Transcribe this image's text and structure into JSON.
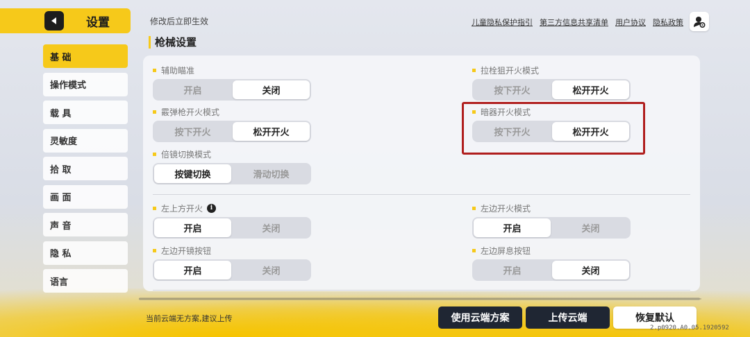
{
  "header": {
    "title": "设置",
    "hint": "修改后立即生效",
    "links": [
      "儿童隐私保护指引",
      "第三方信息共享清单",
      "用户协议",
      "隐私政策"
    ]
  },
  "section_title": "枪械设置",
  "sidebar": {
    "items": [
      {
        "label": "基 础",
        "active": true
      },
      {
        "label": "操作模式",
        "active": false
      },
      {
        "label": "载 具",
        "active": false
      },
      {
        "label": "灵敏度",
        "active": false
      },
      {
        "label": "拾 取",
        "active": false
      },
      {
        "label": "画 面",
        "active": false
      },
      {
        "label": "声 音",
        "active": false
      },
      {
        "label": "隐 私",
        "active": false
      },
      {
        "label": "语言",
        "active": false
      }
    ]
  },
  "options": {
    "aim_assist": {
      "label": "辅助瞄准",
      "a": "开启",
      "b": "关闭",
      "selected": "b"
    },
    "shotgun_fire": {
      "label": "霰弹枪开火模式",
      "a": "按下开火",
      "b": "松开开火",
      "selected": "b"
    },
    "scope_switch": {
      "label": "倍镜切换模式",
      "a": "按键切换",
      "b": "滑动切换",
      "selected": "a"
    },
    "bolt_sniper_fire": {
      "label": "拉栓狙开火模式",
      "a": "按下开火",
      "b": "松开开火",
      "selected": "b"
    },
    "throwable_fire": {
      "label": "暗器开火模式",
      "a": "按下开火",
      "b": "松开开火",
      "selected": "b"
    },
    "top_left_fire": {
      "label": "左上方开火",
      "a": "开启",
      "b": "关闭",
      "selected": "a"
    },
    "left_scope_btn": {
      "label": "左边开镜按钮",
      "a": "开启",
      "b": "关闭",
      "selected": "a"
    },
    "left_fire_mode": {
      "label": "左边开火模式",
      "a": "开启",
      "b": "关闭",
      "selected": "a"
    },
    "left_hold_breath": {
      "label": "左边屏息按钮",
      "a": "开启",
      "b": "关闭",
      "selected": "b"
    }
  },
  "bottom": {
    "hint": "当前云端无方案,建议上传",
    "use_cloud": "使用云端方案",
    "upload_cloud": "上传云端",
    "restore_default": "恢复默认",
    "version": "2.p0920.A0.05.1920592"
  },
  "icons": {
    "back": "back-arrow-icon",
    "user": "user-settings-icon",
    "info": "info-icon"
  },
  "colors": {
    "accent": "#f6c91a",
    "highlight": "#b01e1e",
    "dark_button": "#1f2633"
  }
}
